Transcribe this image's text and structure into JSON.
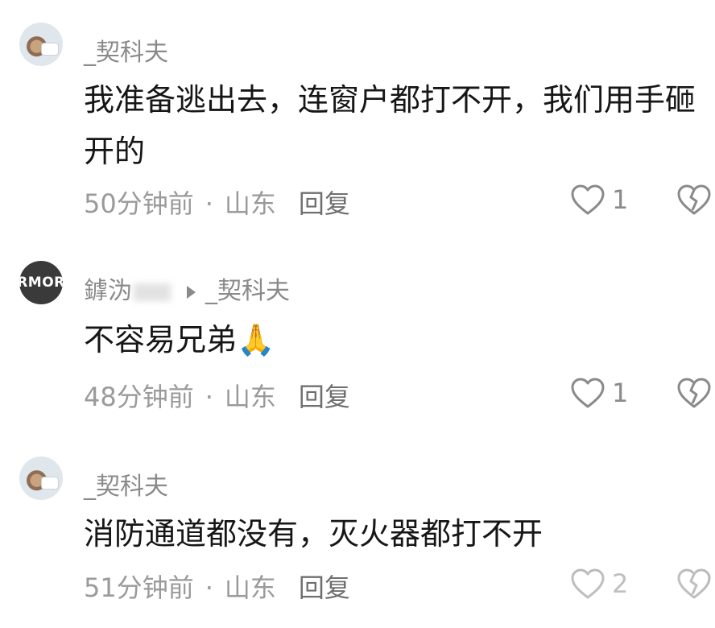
{
  "comments": [
    {
      "username": "_契科夫",
      "reply_to": "",
      "avatar": "photo",
      "text": "我准备逃出去，连窗户都打不开，我们用手砸开的",
      "time": "50分钟前",
      "location": "山东",
      "reply_label": "回复",
      "likes": "1"
    },
    {
      "username": "鎼沩",
      "reply_to": "_契科夫",
      "avatar_text": "RMOR",
      "text": "不容易兄弟🙏",
      "time": "48分钟前",
      "location": "山东",
      "reply_label": "回复",
      "likes": "1"
    },
    {
      "username": "_契科夫",
      "reply_to": "",
      "avatar": "photo",
      "text": "消防通道都没有，灭火器都打不开",
      "time": "51分钟前",
      "location": "山东",
      "reply_label": "回复",
      "likes": "2"
    }
  ],
  "meta_separator": "·",
  "icons": {
    "like": "heart-outline-icon",
    "dislike": "broken-heart-icon"
  }
}
